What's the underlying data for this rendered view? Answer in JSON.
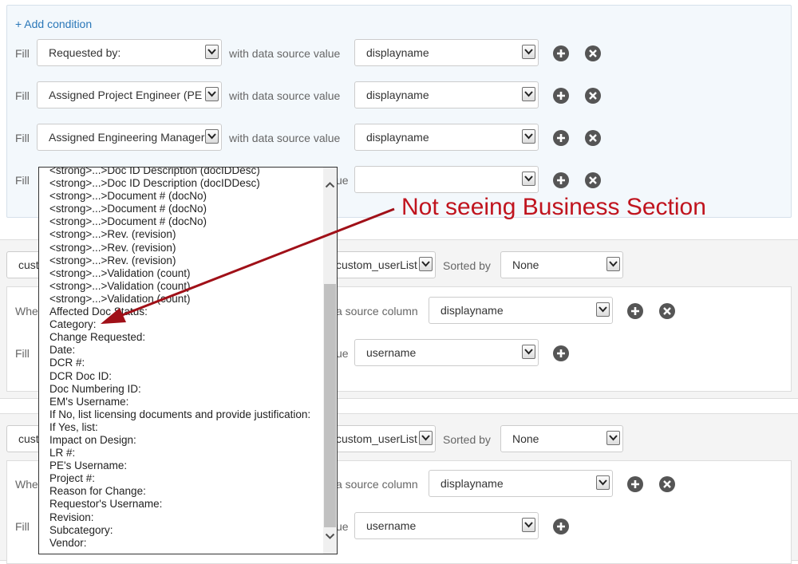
{
  "conditions": {
    "add_condition_label": "+ Add condition",
    "fill_label": "Fill",
    "with_label": "with data source value",
    "rows": [
      {
        "field": "Requested by:",
        "value": "displayname"
      },
      {
        "field": "Assigned Project Engineer (PE",
        "value": "displayname"
      },
      {
        "field": "Assigned Engineering Manager",
        "value": "displayname"
      },
      {
        "field": "",
        "value": ""
      }
    ]
  },
  "section1": {
    "source_select": "cust",
    "list_select": "custom_userList",
    "sorted_by_label": "Sorted by",
    "sort_value": "None",
    "where_label": "Whe",
    "source_column_label": "a source column",
    "source_column_value": "displayname",
    "fill_label": "Fill",
    "value_label_tail": "ue",
    "fill_value": "username"
  },
  "section2": {
    "source_select": "cust",
    "list_select": "custom_userList",
    "sorted_by_label": "Sorted by",
    "sort_value": "None",
    "where_label": "Whe",
    "source_column_label": "a source column",
    "source_column_value": "displayname",
    "fill_label": "Fill",
    "value_label_tail": "ue",
    "fill_value": "username"
  },
  "row4_label_tail": "ue",
  "dropdown": {
    "items": [
      "<strong>...>Doc ID Description (docIDDesc)",
      "<strong>...>Doc ID Description (docIDDesc)",
      "<strong>...>Document # (docNo)",
      "<strong>...>Document # (docNo)",
      "<strong>...>Document # (docNo)",
      "<strong>...>Rev. (revision)",
      "<strong>...>Rev. (revision)",
      "<strong>...>Rev. (revision)",
      "<strong>...>Validation (count)",
      "<strong>...>Validation (count)",
      "<strong>...>Validation (count)",
      "Affected Doc Status:",
      "Category:",
      "Change Requested:",
      "Date:",
      "DCR #:",
      "DCR Doc ID:",
      "Doc Numbering ID:",
      "EM's Username:",
      "If No, list licensing documents and provide justification:",
      "If Yes, list:",
      "Impact on Design:",
      "LR #:",
      "PE's Username:",
      "Project #:",
      "Reason for Change:",
      "Requestor's Username:",
      "Revision:",
      "Subcategory:",
      "Vendor:"
    ]
  },
  "annotation": {
    "text": "Not seeing Business Section",
    "color": "#c0141e"
  }
}
